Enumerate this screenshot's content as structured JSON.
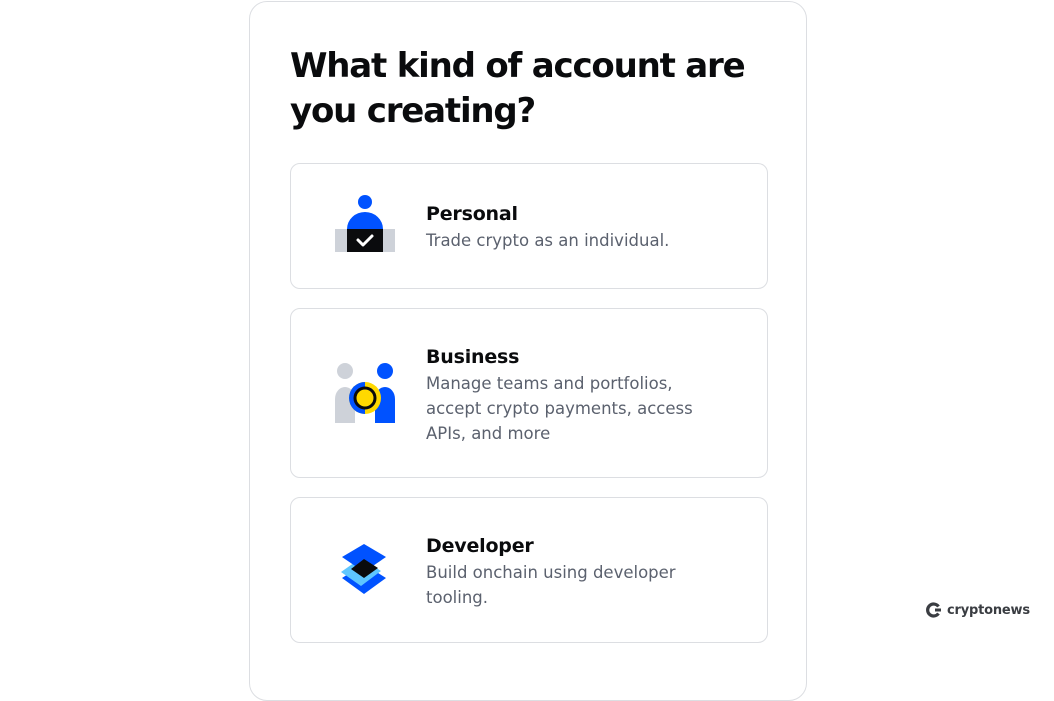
{
  "page": {
    "title": "What kind of account are you creating?"
  },
  "options": [
    {
      "id": "personal",
      "title": "Personal",
      "description": "Trade crypto as an individual.",
      "icon": "person-checkbox-icon"
    },
    {
      "id": "business",
      "title": "Business",
      "description": "Manage teams and portfolios, accept crypto payments, access APIs, and more",
      "icon": "business-people-icon"
    },
    {
      "id": "developer",
      "title": "Developer",
      "description": "Build onchain using developer tooling.",
      "icon": "layered-diamond-icon"
    }
  ],
  "watermark": {
    "text": "cryptonews",
    "icon": "cryptonews-logo-icon"
  },
  "colors": {
    "accent_blue": "#0052ff",
    "light_blue": "#5ec6ff",
    "yellow": "#ffd800",
    "gray": "#ced2d9",
    "text_primary": "#0a0b0d",
    "text_secondary": "#5b616e",
    "border": "#dcdee2"
  }
}
